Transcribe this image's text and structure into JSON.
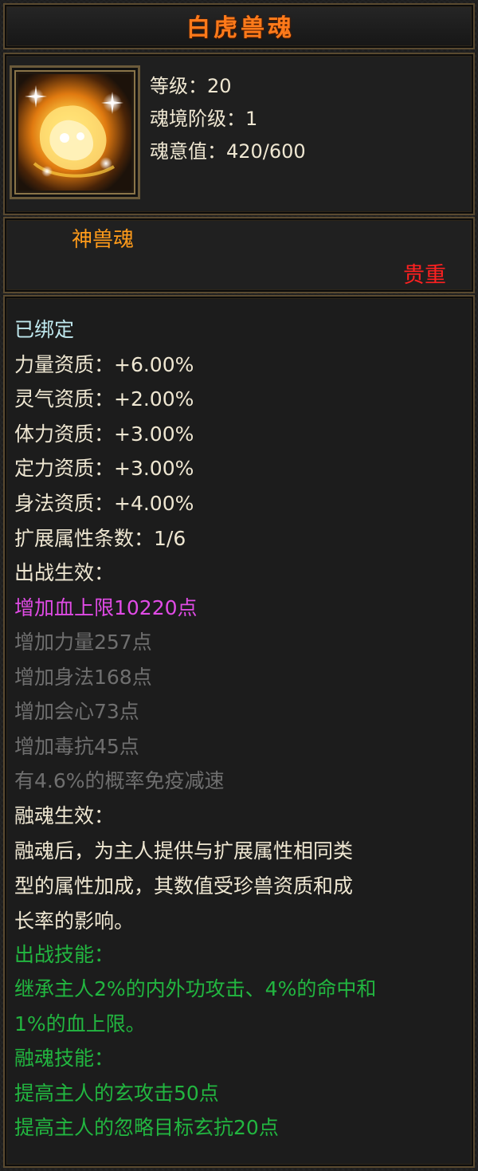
{
  "header": {
    "title": "白虎兽魂"
  },
  "icon": {
    "name": "white-tiger-soul-icon"
  },
  "stats": {
    "level": "等级：20",
    "realm": "魂境阶级：1",
    "soul_value": "魂意值：420/600"
  },
  "type_label": "神兽魂",
  "rarity": "贵重",
  "details": {
    "bound": "已绑定",
    "aptitudes": [
      "力量资质：+6.00%",
      "灵气资质：+2.00%",
      "体力资质：+3.00%",
      "定力资质：+3.00%",
      "身法资质：+4.00%"
    ],
    "ext_count": "扩展属性条数：1/6",
    "battle_effect_heading": "出战生效：",
    "active_attr": "增加血上限10220点",
    "inactive_attrs": [
      "增加力量257点",
      "增加身法168点",
      "增加会心73点",
      "增加毒抗45点",
      "有4.6%的概率免疫减速"
    ],
    "fusion_effect_heading": "融魂生效：",
    "fusion_desc_lines": [
      "融魂后，为主人提供与扩展属性相同类",
      "型的属性加成，其数值受珍兽资质和成",
      "长率的影响。"
    ],
    "battle_skill_heading": "出战技能：",
    "battle_skill_lines": [
      "继承主人2%的内外功攻击、4%的命中和",
      "1%的血上限。"
    ],
    "fusion_skill_heading": "融魂技能：",
    "fusion_skills": [
      "提高主人的玄攻击50点",
      "提高主人的忽略目标玄抗20点"
    ]
  },
  "colors": {
    "title": "#ff7a1a",
    "type_label": "#ff9b1a",
    "rarity": "#ff2020",
    "bound": "#bfe8ee",
    "text": "#efe7d2",
    "active_attr": "#e14be6",
    "inactive_attr": "#6f6f6f",
    "skill": "#22b640"
  }
}
